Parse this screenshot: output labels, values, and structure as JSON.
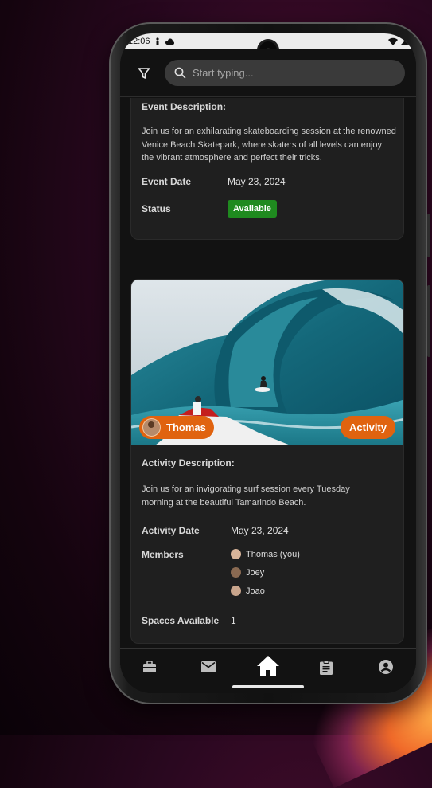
{
  "status_bar": {
    "time": "12:06"
  },
  "search": {
    "placeholder": "Start typing..."
  },
  "event_card": {
    "description_label": "Event Description:",
    "description": "Join us for an exhilarating skateboarding session at the renowned Venice Beach Skatepark, where skaters of all levels can enjoy the vibrant atmosphere and perfect their tricks.",
    "date_label": "Event Date",
    "date_value": "May 23, 2024",
    "status_label": "Status",
    "status_value": "Available"
  },
  "activity_card": {
    "host_name": "Thomas",
    "type_badge": "Activity",
    "description_label": "Activity Description:",
    "description": "Join us for an invigorating surf session every Tuesday morning at the beautiful Tamarindo Beach.",
    "date_label": "Activity Date",
    "date_value": "May 23, 2024",
    "members_label": "Members",
    "members": [
      "Thomas (you)",
      "Joey",
      "Joao"
    ],
    "spaces_label": "Spaces Available",
    "spaces_value": "1"
  },
  "nav": {
    "items": [
      "briefcase-icon",
      "mail-icon",
      "home-icon",
      "clipboard-icon",
      "account-icon"
    ],
    "active": "home-icon"
  },
  "colors": {
    "accent": "#e0630f",
    "status_available": "#1f8a1f",
    "background": "#121212",
    "card": "#1f1f1f"
  }
}
